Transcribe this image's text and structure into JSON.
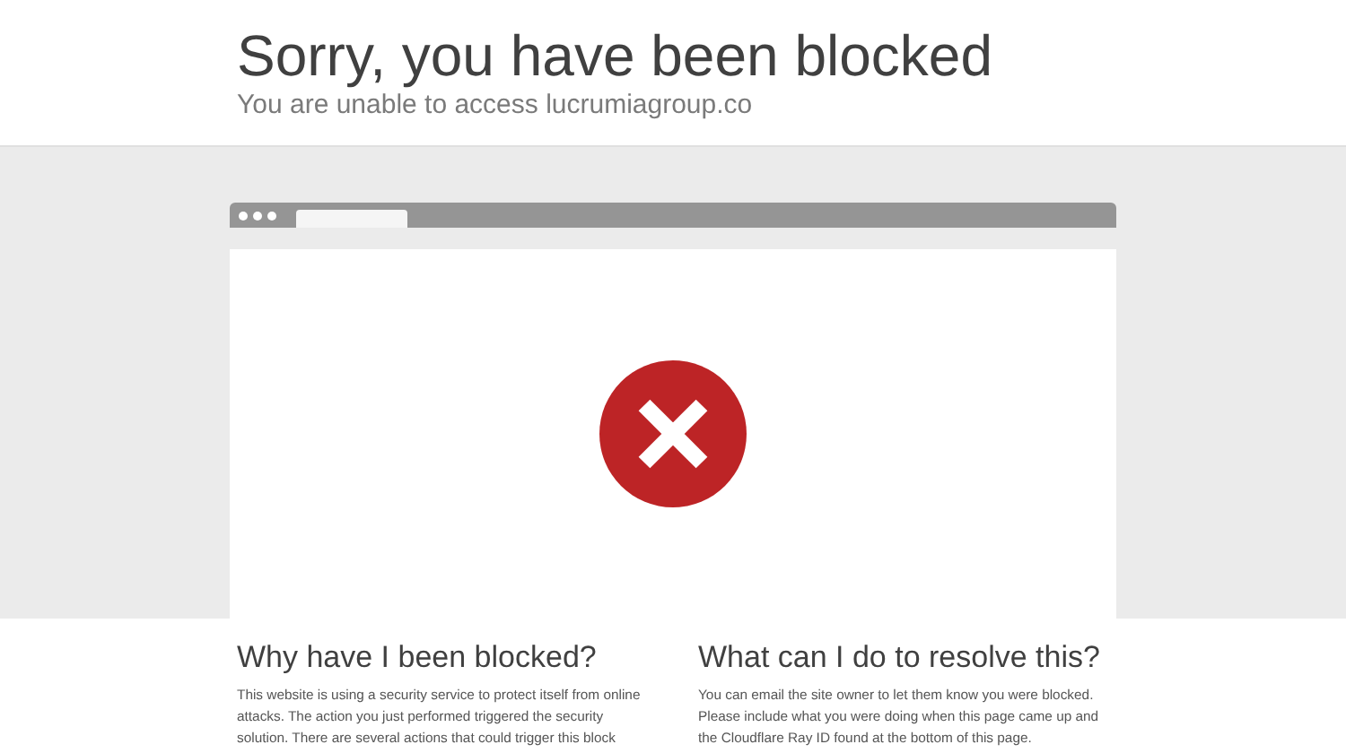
{
  "header": {
    "title": "Sorry, you have been blocked",
    "subtitle": "You are unable to access lucrumiagroup.co"
  },
  "sections": [
    {
      "heading": "Why have I been blocked?",
      "text": "This website is using a security service to protect itself from online attacks. The action you just performed triggered the security solution. There are several actions that could trigger this block"
    },
    {
      "heading": "What can I do to resolve this?",
      "text": "You can email the site owner to let them know you were blocked. Please include what you were doing when this page came up and the Cloudflare Ray ID found at the bottom of this page."
    }
  ]
}
